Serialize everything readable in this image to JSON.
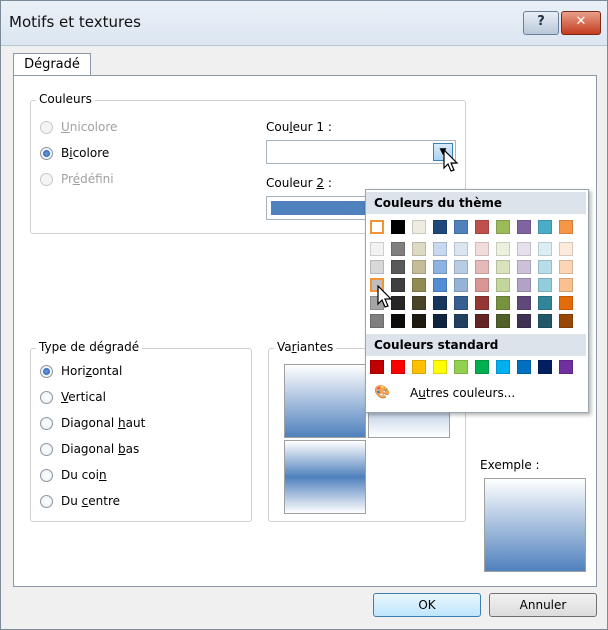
{
  "window": {
    "title": "Motifs et textures",
    "help": "?",
    "close": "✕"
  },
  "tab": "Dégradé",
  "colors_group": {
    "legend": "Couleurs",
    "options": [
      {
        "pre": "",
        "ul": "U",
        "post": "nicolore",
        "state": "disabled"
      },
      {
        "pre": "B",
        "ul": "i",
        "post": "colore",
        "state": "selected"
      },
      {
        "pre": "Pr",
        "ul": "é",
        "post": "défini",
        "state": "disabled"
      }
    ],
    "color1": {
      "pre": "Cou",
      "ul": "l",
      "post": "eur 1 :"
    },
    "color2": {
      "pre": "Couleur ",
      "ul": "2",
      "post": " :"
    },
    "color2_value": "#4f81bd"
  },
  "gradient_type": {
    "legend": "Type de dégradé",
    "options": [
      {
        "pre": "Hori",
        "ul": "z",
        "post": "ontal",
        "state": "selected"
      },
      {
        "pre": "",
        "ul": "V",
        "post": "ertical",
        "state": "normal"
      },
      {
        "pre": "Diagonal ",
        "ul": "h",
        "post": "aut",
        "state": "normal"
      },
      {
        "pre": "Diagonal ",
        "ul": "b",
        "post": "as",
        "state": "normal"
      },
      {
        "pre": "Du coi",
        "ul": "n",
        "post": "",
        "state": "normal"
      },
      {
        "pre": "Du ",
        "ul": "c",
        "post": "entre",
        "state": "normal"
      }
    ]
  },
  "variants": {
    "pre": "Va",
    "ul": "r",
    "post": "iantes"
  },
  "example": "Exemple :",
  "popup": {
    "theme_title": "Couleurs du thème",
    "standard_title": "Couleurs standard",
    "more": {
      "pre": "A",
      "ul": "u",
      "post": "tres couleurs..."
    },
    "theme_top": [
      "#ffffff",
      "#000000",
      "#eeece1",
      "#1f497d",
      "#4f81bd",
      "#c0504d",
      "#9bbb59",
      "#8064a2",
      "#4bacc6",
      "#f79646"
    ],
    "theme_shades": [
      [
        "#f2f2f2",
        "#7f7f7f",
        "#ddd9c3",
        "#c6d9f0",
        "#dbe5f1",
        "#f2dcdb",
        "#ebf1dd",
        "#e5e0ec",
        "#dbeef3",
        "#fdeada"
      ],
      [
        "#d8d8d8",
        "#595959",
        "#c4bd97",
        "#8db3e2",
        "#b8cce4",
        "#e5b9b7",
        "#d7e3bc",
        "#ccc1d9",
        "#b7dde8",
        "#fbd5b5"
      ],
      [
        "#bfbfbf",
        "#3f3f3f",
        "#938953",
        "#548dd4",
        "#95b3d7",
        "#d99694",
        "#c3d69b",
        "#b2a2c7",
        "#92cddc",
        "#fac08f"
      ],
      [
        "#a5a5a5",
        "#262626",
        "#494429",
        "#17365d",
        "#366092",
        "#953734",
        "#76923c",
        "#5f497a",
        "#31859b",
        "#e36c09"
      ],
      [
        "#7f7f7f",
        "#0c0c0c",
        "#1d1b10",
        "#0f243e",
        "#244061",
        "#632423",
        "#4f6128",
        "#3f3151",
        "#205867",
        "#974806"
      ]
    ],
    "standard": [
      "#c00000",
      "#ff0000",
      "#ffc000",
      "#ffff00",
      "#92d050",
      "#00b050",
      "#00b0f0",
      "#0070c0",
      "#002060",
      "#7030a0"
    ]
  },
  "buttons": {
    "ok": "OK",
    "cancel": "Annuler"
  }
}
